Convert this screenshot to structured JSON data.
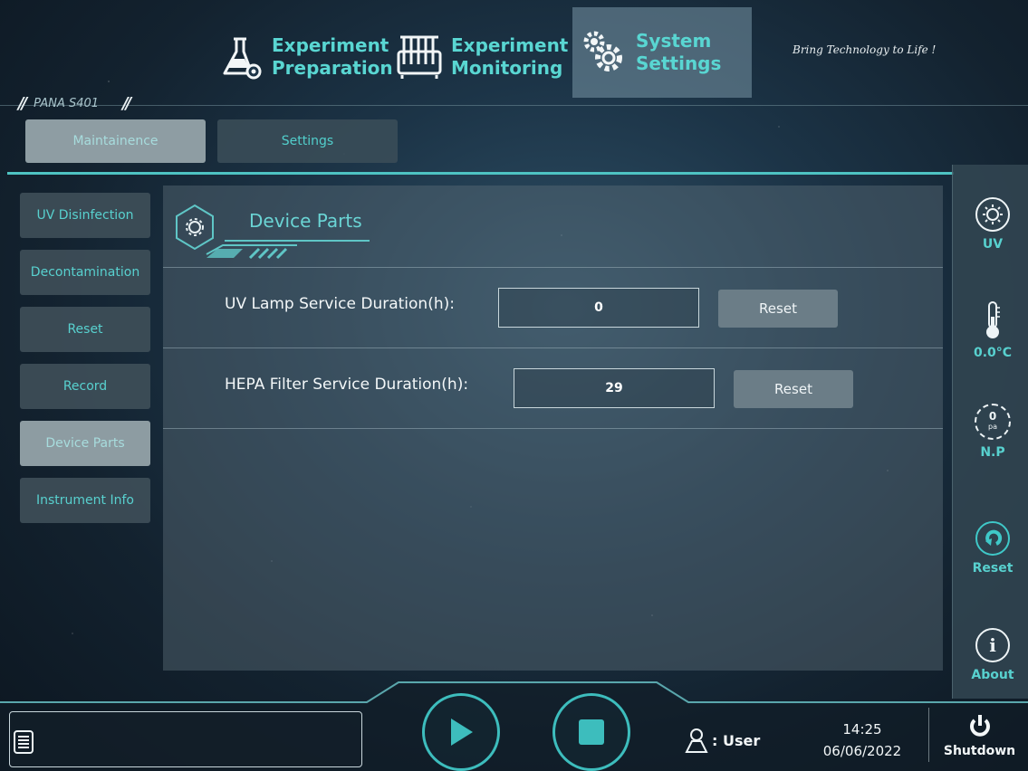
{
  "header": {
    "tabs": [
      {
        "line1": "Experiment",
        "line2": "Preparation",
        "icon": "flask-gear-icon"
      },
      {
        "line1": "Experiment",
        "line2": "Monitoring",
        "icon": "tube-rack-icon"
      },
      {
        "line1": "System",
        "line2": "Settings",
        "icon": "gears-icon",
        "active": true
      }
    ],
    "slogan": "Bring Technology to Life !",
    "brand": "PANA S401"
  },
  "subtabs": [
    {
      "label": "Maintainence",
      "active": true
    },
    {
      "label": "Settings",
      "active": false
    }
  ],
  "sidebar": {
    "items": [
      {
        "label": "UV Disinfection"
      },
      {
        "label": "Decontamination"
      },
      {
        "label": "Reset"
      },
      {
        "label": "Record"
      },
      {
        "label": "Device Parts",
        "active": true
      },
      {
        "label": "Instrument Info"
      }
    ]
  },
  "panel": {
    "title": "Device Parts",
    "rows": [
      {
        "label": "UV Lamp Service Duration(h):",
        "value": "0",
        "button": "Reset"
      },
      {
        "label": "HEPA Filter Service Duration(h):",
        "value": "29",
        "button": "Reset"
      }
    ]
  },
  "status": {
    "uv": "UV",
    "temperature": "0.0°C",
    "pressure_value": "0",
    "pressure_unit": "pa",
    "pressure_label": "N.P",
    "reset": "Reset",
    "about": "About"
  },
  "footer": {
    "user_label": ": User",
    "time": "14:25",
    "date": "06/06/2022",
    "shutdown": "Shutdown"
  },
  "colors": {
    "accent": "#59d6d2",
    "background": "#1c3447",
    "button": "#6b7d87"
  }
}
